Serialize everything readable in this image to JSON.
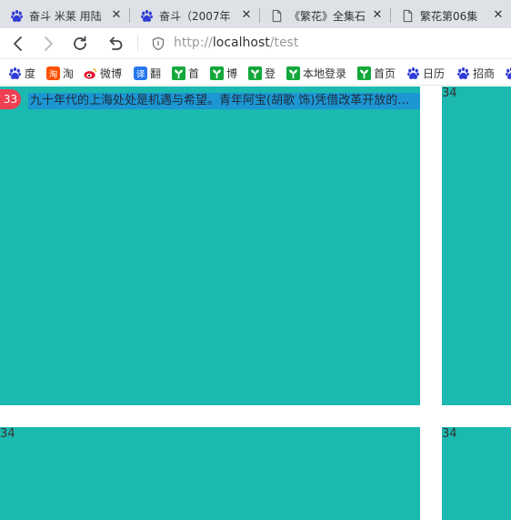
{
  "tabs": [
    {
      "title": "奋斗 米莱 用陆",
      "icon": "paw-icon",
      "close": "✕"
    },
    {
      "title": "奋斗（2007年",
      "icon": "paw-icon",
      "close": "✕"
    },
    {
      "title": "《繁花》全集石",
      "icon": "page-icon",
      "close": "✕"
    },
    {
      "title": "繁花第06集",
      "icon": "page-icon",
      "close": "✕"
    }
  ],
  "address": {
    "scheme": "http://",
    "host": "localhost",
    "path": "/test"
  },
  "bookmarks": [
    {
      "label": "度",
      "icon": "paw-icon"
    },
    {
      "label": "淘",
      "icon": "taobao-icon"
    },
    {
      "label": "微博",
      "icon": "weibo-icon"
    },
    {
      "label": "翻",
      "icon": "translate-icon"
    },
    {
      "label": "首",
      "icon": "sprout-icon"
    },
    {
      "label": "博",
      "icon": "sprout-icon"
    },
    {
      "label": "登",
      "icon": "sprout-icon"
    },
    {
      "label": "本地登录",
      "icon": "sprout-icon"
    },
    {
      "label": "首页",
      "icon": "sprout-icon"
    },
    {
      "label": "日历",
      "icon": "paw-icon"
    },
    {
      "label": "招商",
      "icon": "paw-icon"
    }
  ],
  "cards": [
    {
      "badge": "33",
      "description": "九十年代的上海处处是机遇与希望。青年阿宝(胡歌 饰)凭借改革开放的东风"
    },
    {
      "number": "34"
    },
    {
      "number": "34"
    },
    {
      "number": "34"
    }
  ],
  "colors": {
    "card_bg": "#1cb9b0",
    "badge_bg": "#ef3f52",
    "desc_bg": "#1c97d3",
    "tabstrip_bg": "#dee1e6"
  }
}
